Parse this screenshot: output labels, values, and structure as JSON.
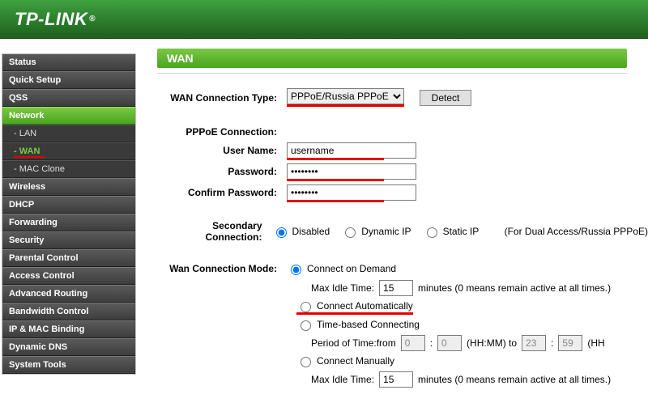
{
  "brand": "TP-LINK",
  "nav": {
    "status": "Status",
    "quick_setup": "Quick Setup",
    "qss": "QSS",
    "network": "Network",
    "lan": "- LAN",
    "wan": "- WAN",
    "mac_clone": "- MAC Clone",
    "wireless": "Wireless",
    "dhcp": "DHCP",
    "forwarding": "Forwarding",
    "security": "Security",
    "parental": "Parental Control",
    "access": "Access Control",
    "adv_routing": "Advanced Routing",
    "bw_control": "Bandwidth Control",
    "ipmac": "IP & MAC Binding",
    "ddns": "Dynamic DNS",
    "systools": "System Tools"
  },
  "page": {
    "title": "WAN"
  },
  "form": {
    "conn_type_label": "WAN Connection Type:",
    "conn_type_value": "PPPoE/Russia PPPoE",
    "detect_btn": "Detect",
    "pppoe_section": "PPPoE Connection:",
    "username_label": "User Name:",
    "username_value": "username",
    "password_label": "Password:",
    "password_value": "********",
    "confirm_label": "Confirm Password:",
    "confirm_value": "********",
    "secondary_label": "Secondary Connection:",
    "disabled": "Disabled",
    "dynip": "Dynamic IP",
    "staticip": "Static IP",
    "dual_note": "(For Dual Access/Russia PPPoE)",
    "mode_label": "Wan Connection Mode:",
    "on_demand": "Connect on Demand",
    "max_idle_label": "Max Idle Time:",
    "max_idle_value": "15",
    "max_idle_note": "minutes (0 means remain active at all times.)",
    "auto": "Connect Automatically",
    "time_based": "Time-based Connecting",
    "period_label": "Period of Time:from",
    "hh1": "0",
    "mm1": "0",
    "hhmm": "(HH:MM) to",
    "hh2": "23",
    "mm2": "59",
    "hh_tail": "(HH",
    "manual": "Connect Manually",
    "max_idle2_value": "15"
  }
}
